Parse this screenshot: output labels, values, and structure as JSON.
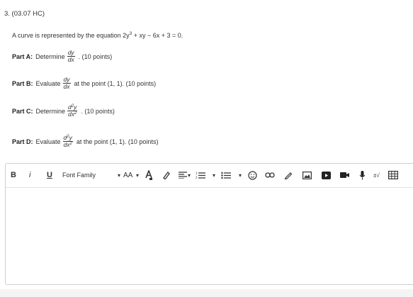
{
  "question": {
    "number": "3. (03.07 HC)",
    "statement_prefix": "A curve is represented by the equation 2y",
    "statement_exp": "3",
    "statement_suffix": " + xy − 6x + 3 = 0."
  },
  "parts": [
    {
      "label": "Part A:",
      "verb": "Determine",
      "num": "dy",
      "num_exp": "",
      "den": "dx",
      "den_exp": "",
      "tail": ". (10 points)"
    },
    {
      "label": "Part B:",
      "verb": "Evaluate",
      "num": "dy",
      "num_exp": "",
      "den": "dx",
      "den_exp": "",
      "tail": " at the point (1, 1). (10 points)"
    },
    {
      "label": "Part C:",
      "verb": "Determine",
      "num": "d",
      "num_exp": "2",
      "num_after": "y",
      "den": "dx",
      "den_exp": "2",
      "tail": ". (10 points)"
    },
    {
      "label": "Part D:",
      "verb": "Evaluate",
      "num": "d",
      "num_exp": "2",
      "num_after": "y",
      "den": "dx",
      "den_exp": "2",
      "tail": " at the point (1, 1). (10 points)"
    }
  ],
  "toolbar": {
    "bold": "B",
    "italic": "i",
    "underline": "U",
    "font_family": "Font Family",
    "font_size": "AA",
    "math_label": "±√"
  }
}
